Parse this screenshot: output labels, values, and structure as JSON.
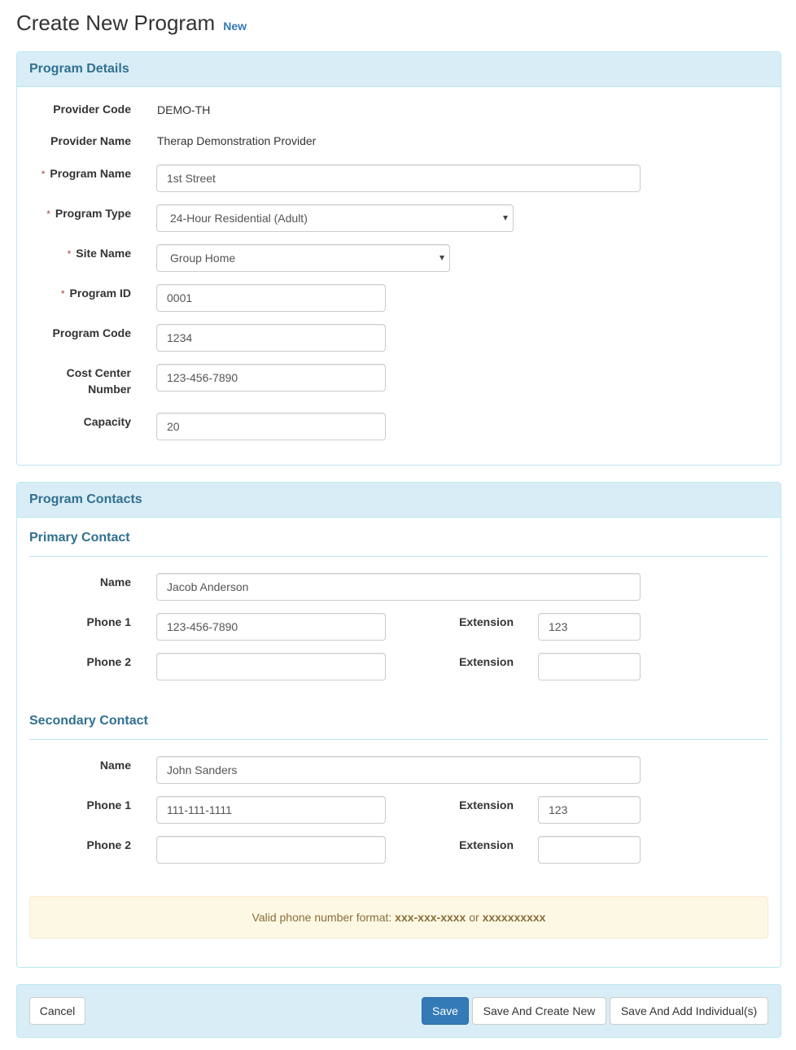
{
  "header": {
    "title": "Create New Program",
    "badge": "New"
  },
  "program_details": {
    "title": "Program Details",
    "provider_code": {
      "label": "Provider Code",
      "value": "DEMO-TH"
    },
    "provider_name": {
      "label": "Provider Name",
      "value": "Therap Demonstration Provider"
    },
    "program_name": {
      "label": "Program Name",
      "required": "*",
      "value": "1st Street"
    },
    "program_type": {
      "label": "Program Type",
      "required": "*",
      "value": "24-Hour Residential (Adult)"
    },
    "site_name": {
      "label": "Site Name",
      "required": "*",
      "value": "Group Home"
    },
    "program_id": {
      "label": "Program ID",
      "required": "*",
      "value": "0001"
    },
    "program_code": {
      "label": "Program Code",
      "value": "1234"
    },
    "cost_center": {
      "label_line1": "Cost Center",
      "label_line2": "Number",
      "value": "123-456-7890"
    },
    "capacity": {
      "label": "Capacity",
      "value": "20"
    }
  },
  "program_contacts": {
    "title": "Program Contacts",
    "primary": {
      "title": "Primary Contact",
      "name_label": "Name",
      "name": "Jacob Anderson",
      "phone1_label": "Phone 1",
      "phone1": "123-456-7890",
      "ext1_label": "Extension",
      "ext1": "123",
      "phone2_label": "Phone 2",
      "phone2": "",
      "ext2_label": "Extension",
      "ext2": ""
    },
    "secondary": {
      "title": "Secondary Contact",
      "name_label": "Name",
      "name": "John Sanders",
      "phone1_label": "Phone 1",
      "phone1": "111-111-1111",
      "ext1_label": "Extension",
      "ext1": "123",
      "phone2_label": "Phone 2",
      "phone2": "",
      "ext2_label": "Extension",
      "ext2": ""
    },
    "alert": {
      "prefix": "Valid phone number format: ",
      "format1": "xxx-xxx-xxxx",
      "or": " or ",
      "format2": "xxxxxxxxxx"
    }
  },
  "footer": {
    "cancel": "Cancel",
    "save": "Save",
    "save_create_new": "Save And Create New",
    "save_add_individuals": "Save And Add Individual(s)"
  }
}
